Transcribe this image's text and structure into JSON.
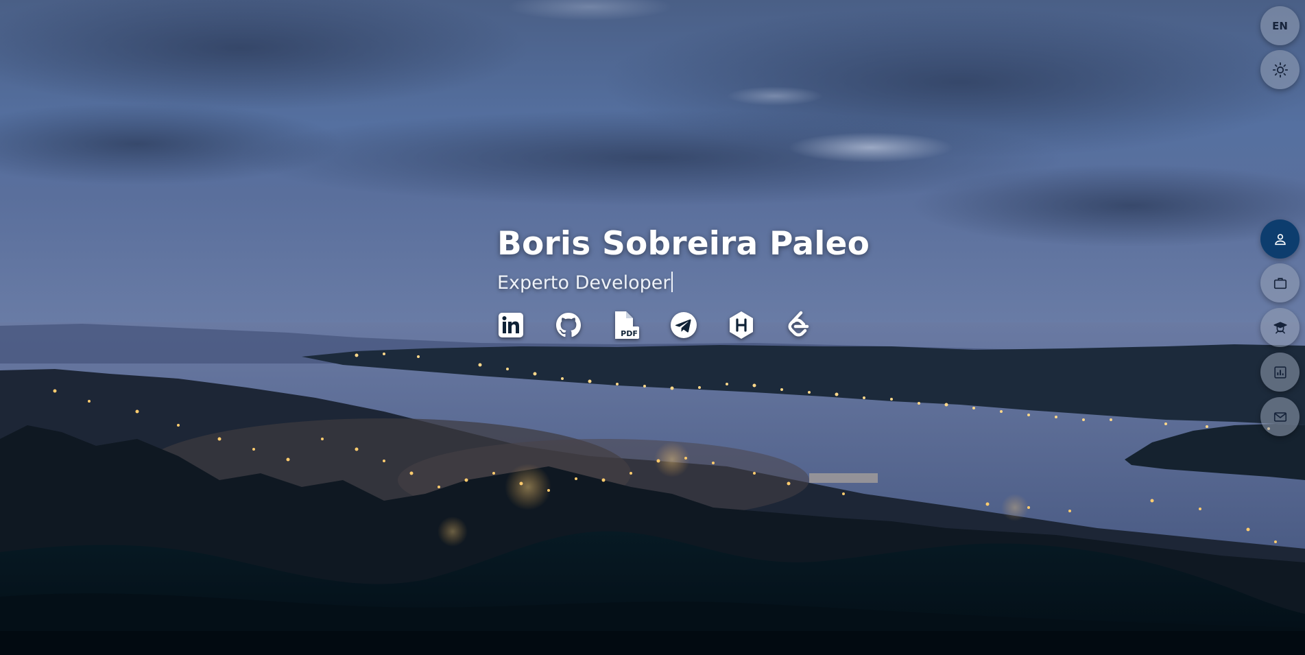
{
  "hero": {
    "name": "Boris Sobreira Paleo",
    "subtitle": "Experto Developer"
  },
  "social_links": [
    {
      "icon": "linkedin-icon"
    },
    {
      "icon": "github-icon"
    },
    {
      "icon": "pdf-file-icon"
    },
    {
      "icon": "telegram-icon"
    },
    {
      "icon": "hackerrank-icon"
    },
    {
      "icon": "leetcode-icon"
    }
  ],
  "top_controls": {
    "language_label": "EN",
    "theme_icon": "sun-icon"
  },
  "section_nav": [
    {
      "icon": "person-icon",
      "active": true
    },
    {
      "icon": "briefcase-icon",
      "active": false
    },
    {
      "icon": "graduate-icon",
      "active": false
    },
    {
      "icon": "bar-chart-icon",
      "active": false
    },
    {
      "icon": "mail-icon",
      "active": false
    }
  ],
  "colors": {
    "accent": "#0d3d6e",
    "button_bg": "#969fb4",
    "text": "#ffffff"
  }
}
